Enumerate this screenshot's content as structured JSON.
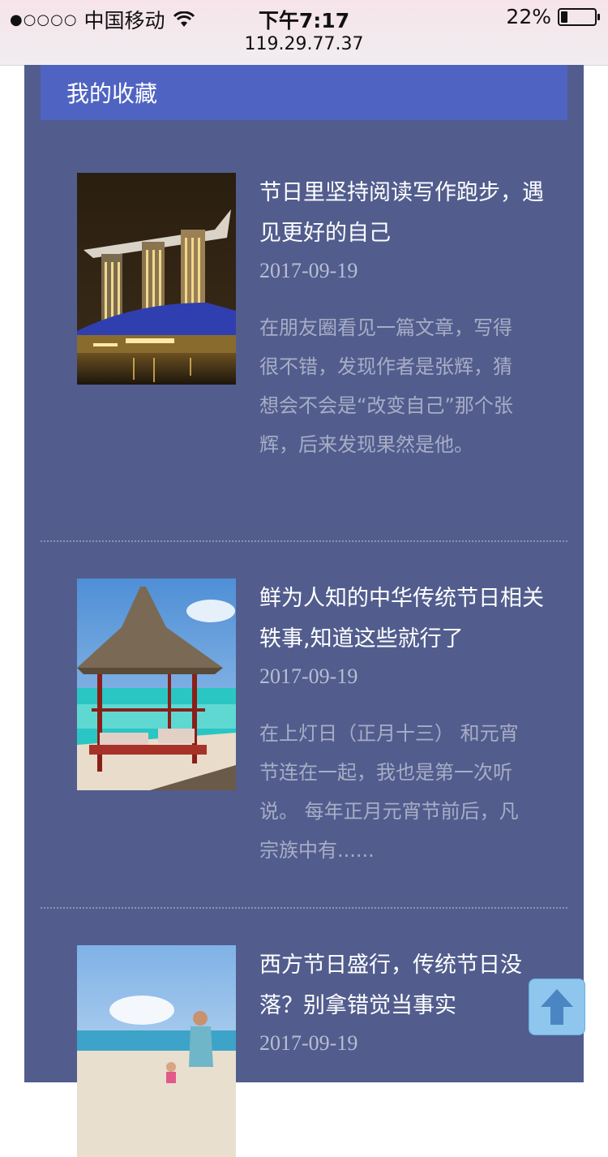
{
  "status_bar": {
    "carrier": "中国移动",
    "signal_dots": "●○○○○",
    "time": "下午7:17",
    "battery_percent": "22%",
    "battery_level": 0.22,
    "url": "119.29.77.37"
  },
  "section": {
    "title": "我的收藏"
  },
  "articles": [
    {
      "title": "节日里坚持阅读写作跑步，遇见更好的自己",
      "date": "2017-09-19",
      "excerpt": "在朋友圈看见一篇文章，写得很不错，发现作者是张辉，猜想会不会是“改变自己”那个张辉，后来发现果然是他。",
      "image": "marina-bay-night-photo"
    },
    {
      "title": "鲜为人知的中华传统节日相关轶事,知道这些就行了",
      "date": "2017-09-19",
      "excerpt": "在上灯日（正月十三） 和元宵节连在一起，我也是第一次听说。 每年正月元宵节前后，凡宗族中有......",
      "image": "beach-gazebo-photo"
    },
    {
      "title": "西方节日盛行，传统节日没落？别拿错觉当事实",
      "date": "2017-09-19",
      "excerpt": "",
      "image": "father-child-beach-photo"
    }
  ],
  "back_to_top": {
    "icon": "arrow-up-icon"
  }
}
